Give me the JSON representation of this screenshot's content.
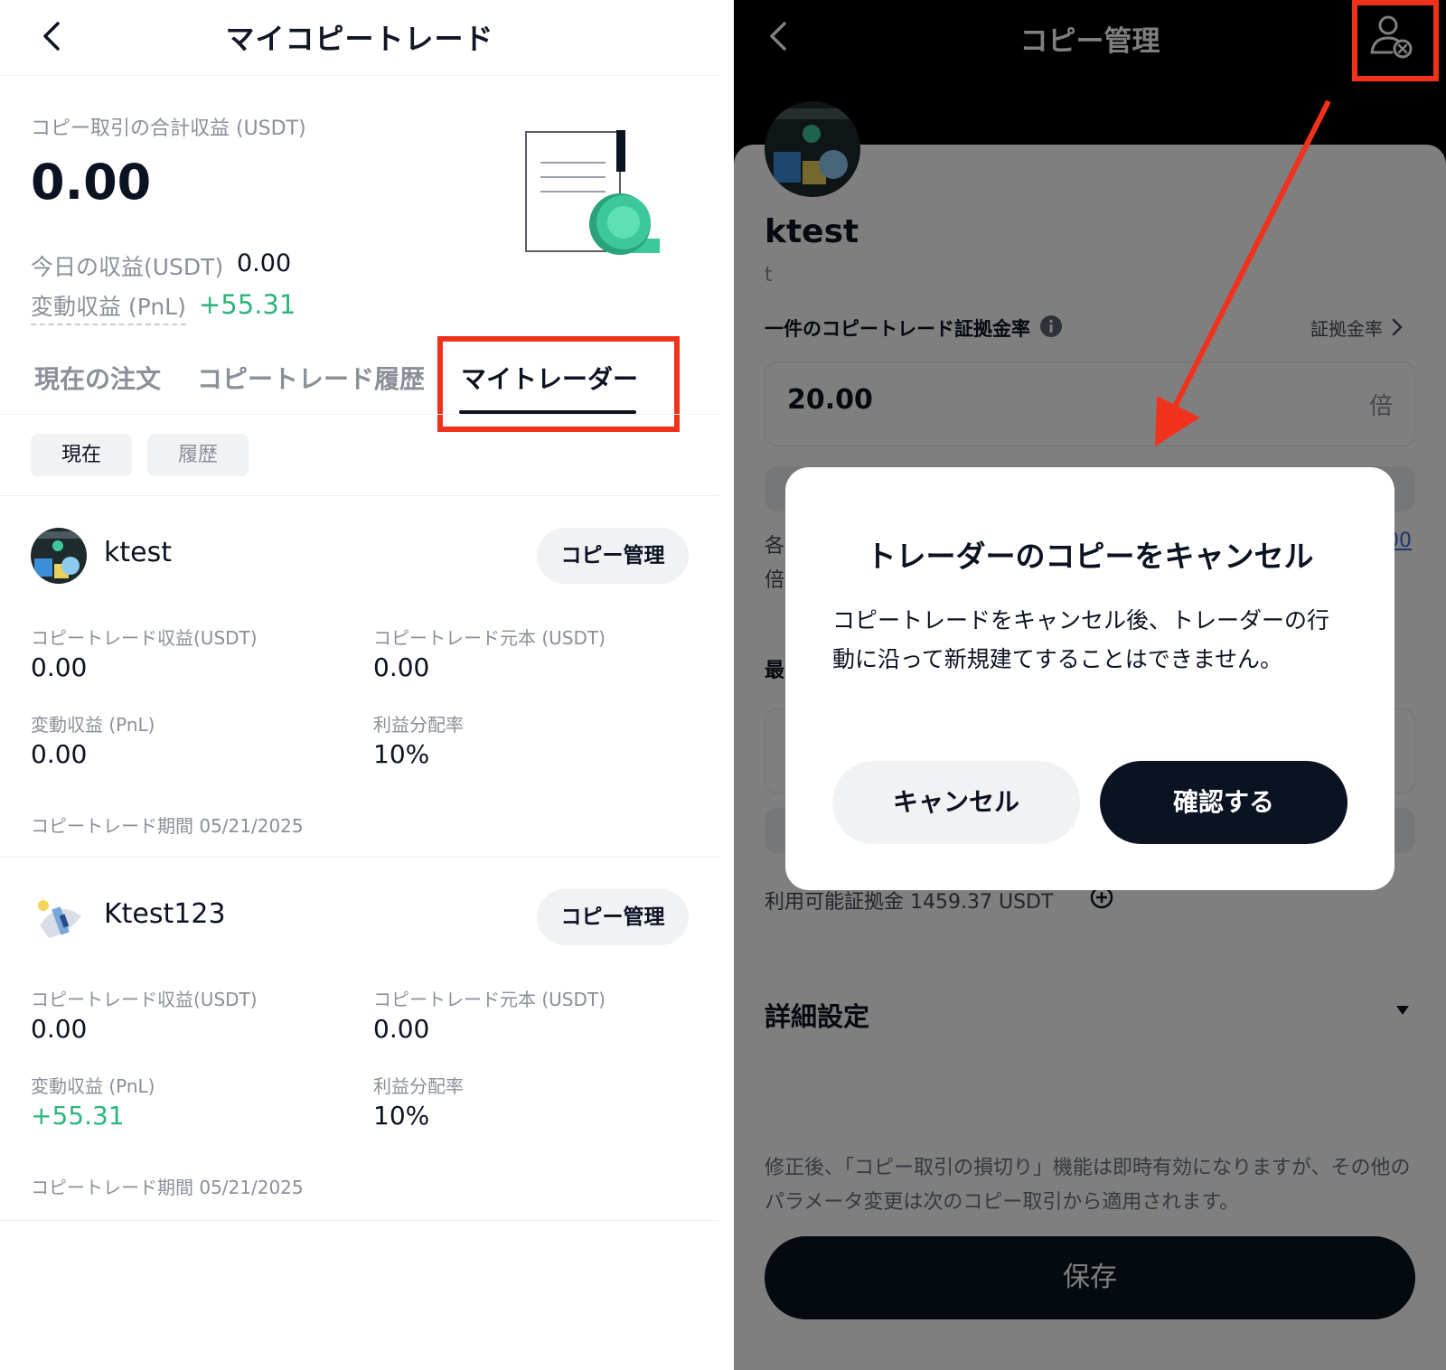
{
  "left": {
    "header": {
      "title": "マイコピートレード"
    },
    "summary": {
      "total_label": "コピー取引の合計収益 (USDT)",
      "total_value": "0.00",
      "today_label": "今日の収益(USDT)",
      "today_value": "0.00",
      "pnl_label": "変動収益 (PnL)",
      "pnl_value": "+55.31"
    },
    "tabs": [
      {
        "label": "現在の注文"
      },
      {
        "label": "コピートレード履歴"
      },
      {
        "label": "マイトレーダー"
      }
    ],
    "chips": [
      {
        "label": "現在"
      },
      {
        "label": "履歴"
      }
    ],
    "traders": [
      {
        "name": "ktest",
        "button": "コピー管理",
        "profit_label": "コピートレード収益(USDT)",
        "profit_value": "0.00",
        "principal_label": "コピートレード元本 (USDT)",
        "principal_value": "0.00",
        "pnl_label": "変動収益 (PnL)",
        "pnl_value": "0.00",
        "share_label": "利益分配率",
        "share_value": "10%",
        "period": "コピートレード期間 05/21/2025"
      },
      {
        "name": "Ktest123",
        "button": "コピー管理",
        "profit_label": "コピートレード収益(USDT)",
        "profit_value": "0.00",
        "principal_label": "コピートレード元本 (USDT)",
        "principal_value": "0.00",
        "pnl_label": "変動収益 (PnL)",
        "pnl_value": "+55.31",
        "share_label": "利益分配率",
        "share_value": "10%",
        "period": "コピートレード期間 05/21/2025"
      }
    ]
  },
  "right": {
    "header": {
      "title": "コピー管理"
    },
    "trader": {
      "name": "ktest",
      "sub": "t"
    },
    "margin_label": "一件のコピートレード証拠金率",
    "margin_link": "証拠金率",
    "margin_value": "20.00",
    "margin_unit": "倍",
    "fragments": {
      "a": "各",
      "b": "倍",
      "c": "00",
      "d": "最"
    },
    "available": "利用可能証拠金 1459.37 USDT",
    "detail_label": "詳細設定",
    "note": "修正後、「コピー取引の損切り」機能は即時有効になりますが、その他のパラメータ変更は次のコピー取引から適用されます。",
    "save_label": "保存",
    "modal": {
      "title": "トレーダーのコピーをキャンセル",
      "body": "コピートレードをキャンセル後、トレーダーの行動に沿って新規建てすることはできません。",
      "cancel_label": "キャンセル",
      "confirm_label": "確認する"
    }
  },
  "colors": {
    "accent_green": "#2eb57c",
    "dark": "#0b1221",
    "highlight_red": "#f0321c",
    "muted": "#8a8f99"
  },
  "icons": [
    "back-arrow-icon",
    "document-coin-icon",
    "user-cancel-icon",
    "info-icon",
    "chevron-right-icon",
    "plus-circle-icon",
    "caret-down-icon"
  ]
}
